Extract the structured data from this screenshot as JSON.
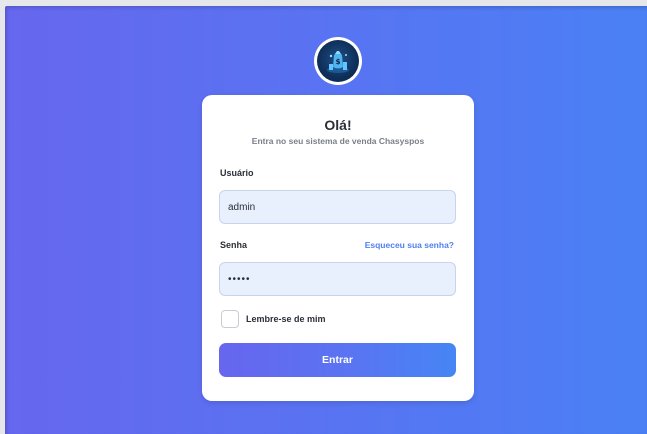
{
  "logo": {
    "icon": "money-bag-logo-icon"
  },
  "card": {
    "title": "Olá!",
    "subtitle": "Entra no seu sistema de venda Chasyspos"
  },
  "form": {
    "username_label": "Usuário",
    "username_value": "admin",
    "password_label": "Senha",
    "forgot_link": "Esqueceu sua senha?",
    "password_value": "•••••",
    "remember_label": "Lembre-se de mim",
    "submit_label": "Entrar"
  },
  "colors": {
    "gradient_start": "#6667ef",
    "gradient_end": "#4a80f4",
    "link": "#4f7ff0",
    "input_bg": "#e8effd"
  }
}
